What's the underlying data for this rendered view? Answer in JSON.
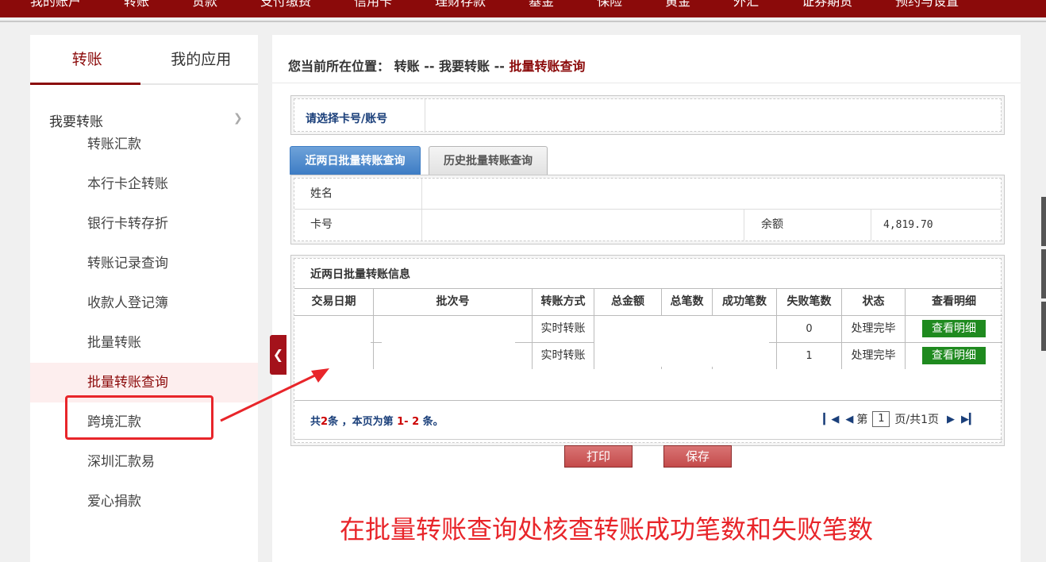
{
  "topnav": [
    "我的账户",
    "转账",
    "贷款",
    "支付缴费",
    "信用卡",
    "理财存款",
    "基金",
    "保险",
    "黄金",
    "外汇",
    "证券期货",
    "预约与设置"
  ],
  "sidebar": {
    "tabs": [
      "转账",
      "我的应用"
    ],
    "section": "我要转账",
    "items": [
      "转账汇款",
      "本行卡企转账",
      "银行卡转存折",
      "转账记录查询",
      "收款人登记簿",
      "批量转账",
      "批量转账查询",
      "跨境汇款",
      "深圳汇款易",
      "爱心捐款"
    ]
  },
  "breadcrumb": {
    "prefix": "您当前所在位置：",
    "l1": "转账",
    "sep": "--",
    "l2": "我要转账",
    "current": "批量转账查询"
  },
  "card_select": {
    "label": "请选择卡号/账号"
  },
  "tabs": {
    "active": "近两日批量转账查询",
    "inactive": "历史批量转账查询"
  },
  "info": {
    "name_label": "姓名",
    "card_label": "卡号",
    "balance_label": "余额",
    "balance": "4,819.70"
  },
  "batch": {
    "title": "近两日批量转账信息",
    "headers": [
      "交易日期",
      "批次号",
      "转账方式",
      "总金额",
      "总笔数",
      "成功笔数",
      "失败笔数",
      "状态",
      "查看明细"
    ],
    "rows": [
      {
        "method": "实时转账",
        "fail": "0",
        "status": "处理完毕",
        "detail": "查看明细"
      },
      {
        "method": "实时转账",
        "fail": "1",
        "status": "处理完毕",
        "detail": "查看明细"
      }
    ],
    "summary": {
      "a": "共",
      "total": "2",
      "b": "条 ，本页为第 ",
      "from": "1",
      "dash": "- ",
      "to": "2",
      "c": " 条。"
    },
    "pager": {
      "page_prefix": "第",
      "page": "1",
      "page_suffix": "页/共1页"
    },
    "print": "打印",
    "save": "保存"
  },
  "annotation": "在批量转账查询处核查转账成功笔数和失败笔数"
}
